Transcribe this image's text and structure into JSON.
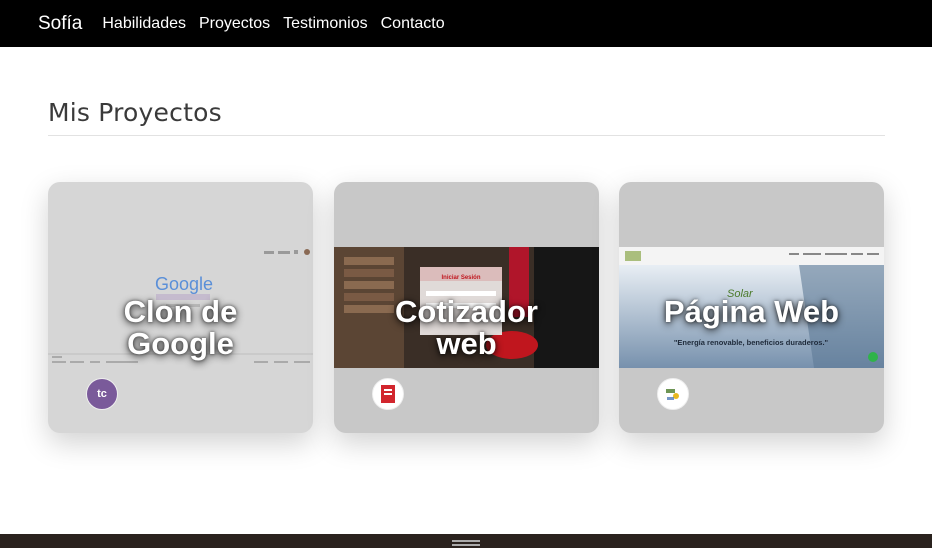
{
  "navbar": {
    "brand": "Sofía",
    "links": [
      "Habilidades",
      "Proyectos",
      "Testimonios",
      "Contacto"
    ]
  },
  "section": {
    "title": "Mis Proyectos"
  },
  "projects": [
    {
      "title_line1": "Clon de",
      "title_line2": "Google",
      "avatar_text": "tc",
      "preview": {
        "logo": "Google"
      }
    },
    {
      "title_line1": "Cotizador",
      "title_line2": "web",
      "avatar_text": "",
      "preview": {
        "panel_title": "Iniciar Sesión"
      }
    },
    {
      "title_line1": "Página Web",
      "title_line2": "",
      "avatar_text": "",
      "preview": {
        "brand_mark": "Solar",
        "tagline": "\"Energía renovable, beneficios duraderos.\""
      }
    }
  ],
  "colors": {
    "navbar_bg": "#000000",
    "footer_bg": "#2a221e",
    "card_bg": "#c8c8c8"
  }
}
